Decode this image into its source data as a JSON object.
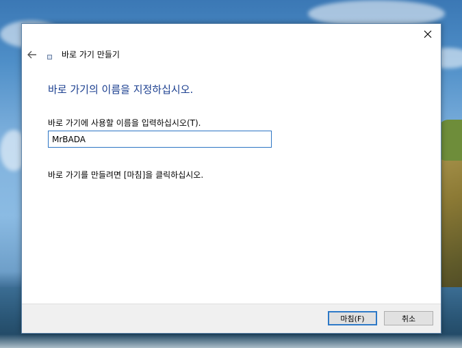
{
  "dialog": {
    "wizard_title": "바로 가기 만들기",
    "heading": "바로 가기의 이름을 지정하십시오.",
    "field_label": "바로 가기에 사용할 이름을 입력하십시오(T).",
    "name_value": "MrBADA",
    "hint": "바로 가기를 만들려면 [마침]을 클릭하십시오.",
    "buttons": {
      "finish": "마침(F)",
      "cancel": "취소"
    }
  },
  "colors": {
    "heading": "#1a3e8f",
    "input_border": "#2a73c3",
    "default_button_border": "#2c78c7"
  },
  "icons": [
    "close-icon",
    "back-arrow-icon",
    "shortcut-wizard-icon"
  ]
}
